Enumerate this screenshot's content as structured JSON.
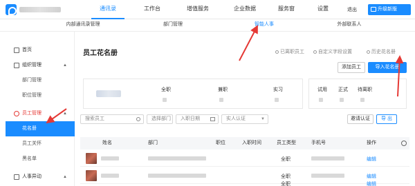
{
  "topnav": {
    "tabs": [
      "通讯录",
      "工作台",
      "增值服务",
      "企业数据",
      "服务窗",
      "设置"
    ],
    "logout": "退出",
    "upgrade": "升级新版"
  },
  "subnav": {
    "tabs": [
      "内部通讯录管理",
      "部门管理",
      "智能人事",
      "外部联系人"
    ]
  },
  "sidebar": {
    "home": "首页",
    "org_group": "组织管理",
    "org_items": [
      "部门管理",
      "职位管理"
    ],
    "emp_group": "员工管理",
    "emp_items": [
      "花名册",
      "员工关怀",
      "黑名单"
    ],
    "hr_group": "人事异动"
  },
  "main": {
    "title": "员工花名册",
    "options": [
      "已离职员工",
      "自定义字段设置",
      "历史花名册"
    ],
    "add_btn": "添加员工",
    "import_btn": "导入花名册",
    "stats_left": [
      "全职",
      "兼职",
      "实习"
    ],
    "stats_right": [
      "试用",
      "正式",
      "待离职"
    ],
    "filters": {
      "search_placeholder": "搜索员工",
      "dept": "选择部门",
      "date": "入职日期",
      "auth": "实人认证"
    },
    "auth_btn": "邀请认证",
    "export_btn": "导 出",
    "columns": [
      "姓名",
      "部门",
      "职位",
      "入职时间",
      "员工类型",
      "手机号",
      "操作"
    ],
    "rows": [
      {
        "type": "全职",
        "action": "编辑"
      },
      {
        "type": "全职",
        "action": "编辑"
      },
      {
        "type": "全职",
        "action": "编辑"
      }
    ]
  },
  "colors": {
    "accent": "#1a8cff",
    "arrow": "#e53935"
  }
}
